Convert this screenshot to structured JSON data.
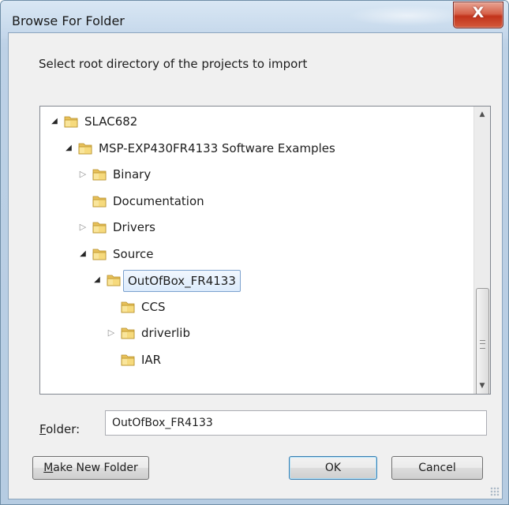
{
  "window": {
    "title": "Browse For Folder",
    "close_glyph": "X"
  },
  "prompt": "Select root directory of the projects to import",
  "tree": {
    "nodes": [
      {
        "label": "SLAC682",
        "level": 0,
        "expander": "expanded"
      },
      {
        "label": "MSP-EXP430FR4133 Software Examples",
        "level": 1,
        "expander": "expanded"
      },
      {
        "label": "Binary",
        "level": 2,
        "expander": "collapsed"
      },
      {
        "label": "Documentation",
        "level": 2,
        "expander": "none"
      },
      {
        "label": "Drivers",
        "level": 2,
        "expander": "collapsed"
      },
      {
        "label": "Source",
        "level": 2,
        "expander": "expanded"
      },
      {
        "label": "OutOfBox_FR4133",
        "level": 3,
        "expander": "expanded",
        "selected": true
      },
      {
        "label": "CCS",
        "level": 4,
        "expander": "none"
      },
      {
        "label": "driverlib",
        "level": 4,
        "expander": "collapsed"
      },
      {
        "label": "IAR",
        "level": 4,
        "expander": "none"
      }
    ],
    "icons": {
      "expanded": "expanded-triangle-icon",
      "collapsed": "collapsed-triangle-icon",
      "folder": "folder-icon"
    }
  },
  "folder_field": {
    "label_accel": "F",
    "label_rest": "older:",
    "value": "OutOfBox_FR4133"
  },
  "buttons": {
    "make_new_folder_accel": "M",
    "make_new_folder_rest": "ake New Folder",
    "ok": "OK",
    "cancel": "Cancel"
  },
  "colors": {
    "selection_border": "#7da2ce",
    "folder_yellow": "#f3d36b",
    "close_red": "#c2331b"
  }
}
